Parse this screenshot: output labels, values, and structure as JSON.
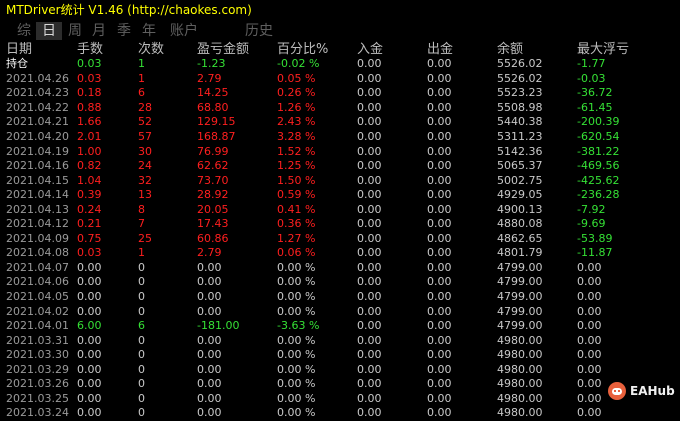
{
  "window": {
    "title": "MTDriver统计 V1.46  (http://chaokes.com)"
  },
  "tabs": [
    {
      "label": "综",
      "active": false
    },
    {
      "label": "日",
      "active": true
    },
    {
      "label": "周",
      "active": false
    },
    {
      "label": "月",
      "active": false
    },
    {
      "label": "季",
      "active": false
    },
    {
      "label": "年",
      "active": false
    },
    {
      "label": "账户",
      "active": false
    },
    {
      "label": "历史",
      "active": false
    }
  ],
  "table": {
    "headers": [
      "日期",
      "手数",
      "次数",
      "盈亏金额",
      "百分比%",
      "入金",
      "出金",
      "余额",
      "最大浮亏"
    ],
    "rows": [
      [
        "持仓",
        "0.03",
        "1",
        "-1.23",
        "-0.02 %",
        "0.00",
        "0.00",
        "5526.02",
        "-1.77"
      ],
      [
        "2021.04.26",
        "0.03",
        "1",
        "2.79",
        "0.05 %",
        "0.00",
        "0.00",
        "5526.02",
        "-0.03"
      ],
      [
        "2021.04.23",
        "0.18",
        "6",
        "14.25",
        "0.26 %",
        "0.00",
        "0.00",
        "5523.23",
        "-36.72"
      ],
      [
        "2021.04.22",
        "0.88",
        "28",
        "68.80",
        "1.26 %",
        "0.00",
        "0.00",
        "5508.98",
        "-61.45"
      ],
      [
        "2021.04.21",
        "1.66",
        "52",
        "129.15",
        "2.43 %",
        "0.00",
        "0.00",
        "5440.38",
        "-200.39"
      ],
      [
        "2021.04.20",
        "2.01",
        "57",
        "168.87",
        "3.28 %",
        "0.00",
        "0.00",
        "5311.23",
        "-620.54"
      ],
      [
        "2021.04.19",
        "1.00",
        "30",
        "76.99",
        "1.52 %",
        "0.00",
        "0.00",
        "5142.36",
        "-381.22"
      ],
      [
        "2021.04.16",
        "0.82",
        "24",
        "62.62",
        "1.25 %",
        "0.00",
        "0.00",
        "5065.37",
        "-469.56"
      ],
      [
        "2021.04.15",
        "1.04",
        "32",
        "73.70",
        "1.50 %",
        "0.00",
        "0.00",
        "5002.75",
        "-425.62"
      ],
      [
        "2021.04.14",
        "0.39",
        "13",
        "28.92",
        "0.59 %",
        "0.00",
        "0.00",
        "4929.05",
        "-236.28"
      ],
      [
        "2021.04.13",
        "0.24",
        "8",
        "20.05",
        "0.41 %",
        "0.00",
        "0.00",
        "4900.13",
        "-7.92"
      ],
      [
        "2021.04.12",
        "0.21",
        "7",
        "17.43",
        "0.36 %",
        "0.00",
        "0.00",
        "4880.08",
        "-9.69"
      ],
      [
        "2021.04.09",
        "0.75",
        "25",
        "60.86",
        "1.27 %",
        "0.00",
        "0.00",
        "4862.65",
        "-53.89"
      ],
      [
        "2021.04.08",
        "0.03",
        "1",
        "2.79",
        "0.06 %",
        "0.00",
        "0.00",
        "4801.79",
        "-11.87"
      ],
      [
        "2021.04.07",
        "0.00",
        "0",
        "0.00",
        "0.00 %",
        "0.00",
        "0.00",
        "4799.00",
        "0.00"
      ],
      [
        "2021.04.06",
        "0.00",
        "0",
        "0.00",
        "0.00 %",
        "0.00",
        "0.00",
        "4799.00",
        "0.00"
      ],
      [
        "2021.04.05",
        "0.00",
        "0",
        "0.00",
        "0.00 %",
        "0.00",
        "0.00",
        "4799.00",
        "0.00"
      ],
      [
        "2021.04.02",
        "0.00",
        "0",
        "0.00",
        "0.00 %",
        "0.00",
        "0.00",
        "4799.00",
        "0.00"
      ],
      [
        "2021.04.01",
        "6.00",
        "6",
        "-181.00",
        "-3.63 %",
        "0.00",
        "0.00",
        "4799.00",
        "0.00"
      ],
      [
        "2021.03.31",
        "0.00",
        "0",
        "0.00",
        "0.00 %",
        "0.00",
        "0.00",
        "4980.00",
        "0.00"
      ],
      [
        "2021.03.30",
        "0.00",
        "0",
        "0.00",
        "0.00 %",
        "0.00",
        "0.00",
        "4980.00",
        "0.00"
      ],
      [
        "2021.03.29",
        "0.00",
        "0",
        "0.00",
        "0.00 %",
        "0.00",
        "0.00",
        "4980.00",
        "0.00"
      ],
      [
        "2021.03.26",
        "0.00",
        "0",
        "0.00",
        "0.00 %",
        "0.00",
        "0.00",
        "4980.00",
        "0.00"
      ],
      [
        "2021.03.25",
        "0.00",
        "0",
        "0.00",
        "0.00 %",
        "0.00",
        "0.00",
        "4980.00",
        "0.00"
      ],
      [
        "2021.03.24",
        "0.00",
        "0",
        "0.00",
        "0.00 %",
        "0.00",
        "0.00",
        "4980.00",
        "0.00"
      ]
    ]
  },
  "watermark": {
    "text": "EAHub"
  },
  "colors": {
    "title": "#ffff00",
    "profit": "#ff1f1f",
    "loss": "#35e035",
    "neutral": "#c8c8c8",
    "background": "#000000"
  }
}
